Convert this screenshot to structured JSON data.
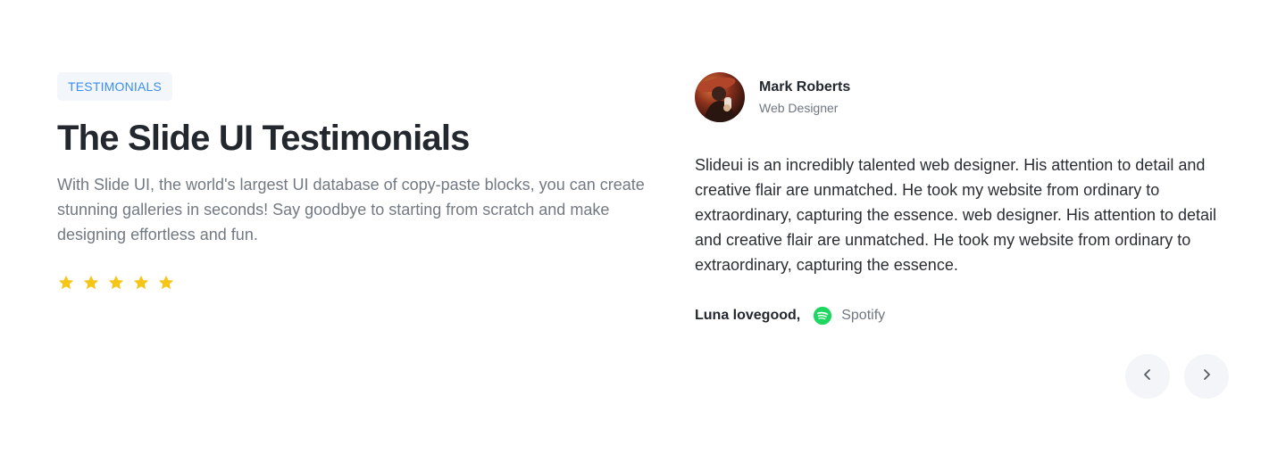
{
  "section": {
    "badge": "TESTIMONIALS",
    "title": "The Slide UI Testimonials",
    "description": "With Slide UI, the world's largest UI database of copy-paste blocks, you can create stunning galleries in seconds! Say goodbye to starting from scratch and make designing effortless and fun.",
    "rating": 5,
    "star_color": "#f5c518"
  },
  "testimonial": {
    "author_name": "Mark Roberts",
    "author_role": "Web Designer",
    "quote": "Slideui is an incredibly talented web designer. His attention to detail and creative flair are unmatched. He took my website from ordinary to extraordinary, capturing the essence. web designer. His attention to detail and creative flair are unmatched. He took my website from ordinary to extraordinary, capturing the essence.",
    "source_name": "Luna lovegood,",
    "source_company": "Spotify",
    "source_icon": "spotify-icon",
    "source_color": "#1ed760"
  },
  "navigation": {
    "prev_icon": "chevron-left-icon",
    "next_icon": "chevron-right-icon"
  }
}
